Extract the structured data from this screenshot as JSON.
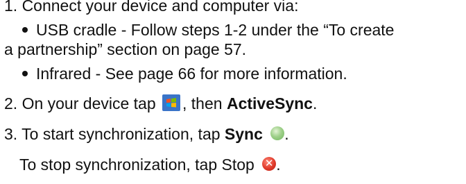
{
  "steps": {
    "s1": "1. Connect your device and computer via:",
    "b1": "USB cradle - Follow steps 1-2 under the “To create",
    "b1_cont": "a partnership” section on page 57.",
    "b2": "Infrared - See page 66 for more information.",
    "s2_prefix": "2. On your device tap",
    "s2_mid": ", then",
    "s2_bold": "ActiveSync",
    "s2_end": ".",
    "s3_prefix": "3. To start synchronization, tap",
    "s3_bold": "Sync",
    "s3_end": ".",
    "s4_prefix": "To stop synchronization, tap Stop",
    "s4_end": "."
  },
  "icons": {
    "start": "windows-start-icon",
    "sync": "sync-icon",
    "stop": "stop-icon",
    "stop_glyph": "✕"
  }
}
